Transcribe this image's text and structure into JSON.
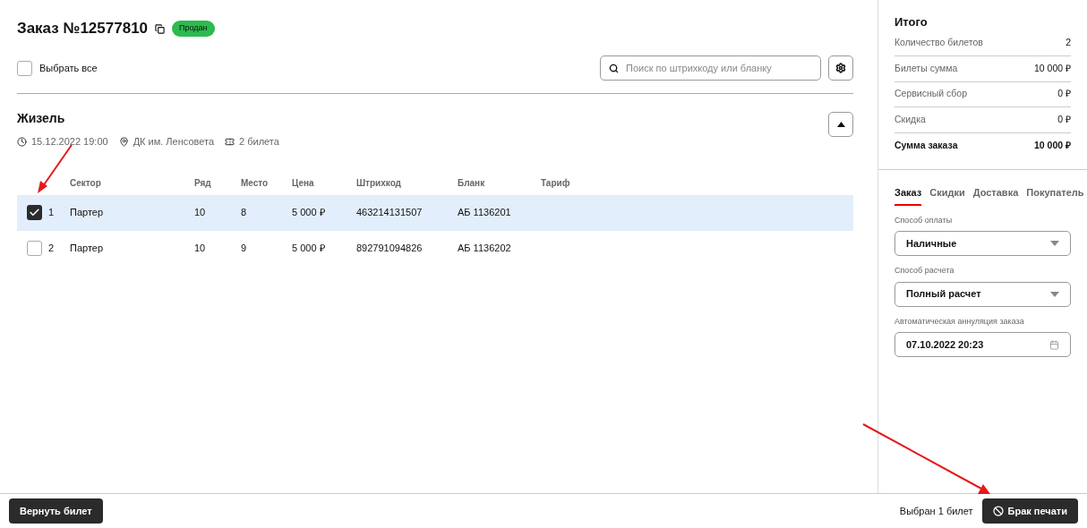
{
  "order": {
    "title": "Заказ №12577810",
    "status": "Продан"
  },
  "select_all": {
    "label": "Выбрать все",
    "checked": false
  },
  "search": {
    "placeholder": "Поиск по штрихкоду или бланку"
  },
  "event": {
    "title": "Жизель",
    "date": "15.12.2022 19:00",
    "venue": "ДК им. Ленсовета",
    "tickets": "2 билета",
    "expanded": true
  },
  "table": {
    "columns": [
      "Сектор",
      "Ряд",
      "Место",
      "Цена",
      "Штрихкод",
      "Бланк",
      "Тариф"
    ],
    "rows": [
      {
        "number": "1",
        "cells": [
          "Партер",
          "10",
          "8",
          "5 000 ₽",
          "463214131507",
          "АБ 1136201",
          ""
        ],
        "selected": true
      },
      {
        "number": "2",
        "cells": [
          "Партер",
          "10",
          "9",
          "5 000 ₽",
          "892791094826",
          "АБ 1136202",
          ""
        ],
        "selected": false
      }
    ]
  },
  "summary": {
    "title": "Итого",
    "rows": [
      {
        "label": "Количество билетов",
        "value": "2",
        "kind": "normal"
      },
      {
        "label": "Билеты сумма",
        "value": "10 000 ₽",
        "kind": "normal"
      },
      {
        "label": "Сервисный сбор",
        "value": "0 ₽",
        "kind": "normal"
      },
      {
        "label": "Скидка",
        "value": "0 ₽",
        "kind": "normal"
      },
      {
        "label": "Сумма заказа",
        "value": "10 000 ₽",
        "kind": "total"
      }
    ]
  },
  "tabs": [
    {
      "label": "Заказ",
      "selected": true
    },
    {
      "label": "Скидки",
      "selected": false
    },
    {
      "label": "Доставка",
      "selected": false
    },
    {
      "label": "Покупатель",
      "selected": false
    }
  ],
  "fields": [
    {
      "label": "Способ оплаты",
      "value": "Наличные",
      "kind": "select"
    },
    {
      "label": "Способ расчета",
      "value": "Полный расчет",
      "kind": "select"
    },
    {
      "label": "Автоматическая аннуляция заказа",
      "value": "07.10.2022 20:23",
      "kind": "date"
    }
  ],
  "footer": {
    "return_button": "Вернуть билет",
    "selection": "Выбран 1 билет",
    "defect_button": "Брак печати"
  }
}
